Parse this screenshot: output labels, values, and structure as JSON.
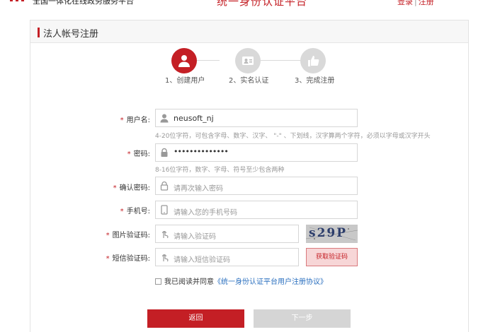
{
  "header": {
    "site_name": "全国一体化在线政务服务平台",
    "center_title": "统一身份认证平台",
    "login_label": "登录",
    "separator": "|",
    "register_label": "注册"
  },
  "panel": {
    "title": "法人帐号注册"
  },
  "steps": [
    {
      "label": "1、创建用户",
      "active": true
    },
    {
      "label": "2、实名认证",
      "active": false
    },
    {
      "label": "3、完成注册",
      "active": false
    }
  ],
  "form": {
    "required_mark": "*",
    "username": {
      "label": "用户名:",
      "value": "neusoft_nj",
      "hint": "4-20位字符，可包含字母、数字、汉字、 \"-\" 、下划线，汉字算两个字符，必须以字母或汉字开头"
    },
    "password": {
      "label": "密码:",
      "value": "••••••••••••••",
      "hint": "8-16位字符，数字、字母、符号至少包含两种"
    },
    "confirm_password": {
      "label": "确认密码:",
      "placeholder": "请再次输入密码"
    },
    "phone": {
      "label": "手机号:",
      "placeholder": "请输入您的手机号码"
    },
    "image_code": {
      "label": "图片验证码:",
      "placeholder": "请输入验证码",
      "captcha_text": "s29P"
    },
    "sms_code": {
      "label": "短信验证码:",
      "placeholder": "请输入短信验证码",
      "button_label": "获取验证码"
    },
    "agreement": {
      "text": "我已阅读并同意",
      "link": "《统一身份认证平台用户注册协议》"
    }
  },
  "actions": {
    "back_label": "返回",
    "next_label": "下一步"
  },
  "colors": {
    "accent": "#c41f25",
    "step_inactive": "#d9d9d9",
    "link": "#2a6fbf"
  }
}
